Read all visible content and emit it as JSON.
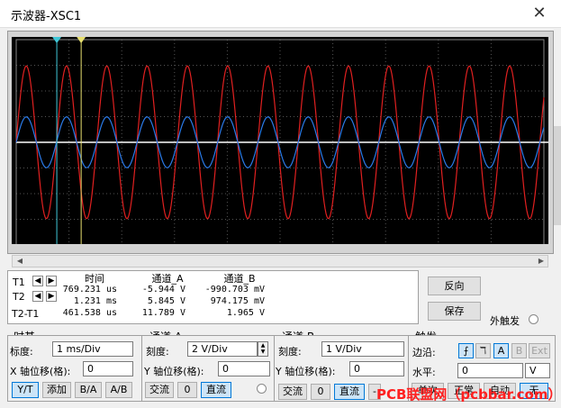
{
  "window": {
    "title": "示波器-XSC1"
  },
  "cursor_table": {
    "rows": [
      {
        "label": "T1",
        "time": "769.231 us",
        "chA": "-5.944 V",
        "chB": "-990.703 mV"
      },
      {
        "label": "T2",
        "time": "1.231 ms",
        "chA": "5.845 V",
        "chB": "974.175 mV"
      },
      {
        "label": "T2-T1",
        "time": "461.538 us",
        "chA": "11.789 V",
        "chB": "1.965 V"
      }
    ],
    "headers": {
      "time": "时间",
      "chA": "通道_A",
      "chB": "通道_B"
    }
  },
  "buttons": {
    "reverse": "反向",
    "save": "保存",
    "ext_trigger": "外触发"
  },
  "timebase": {
    "title": "时基",
    "scale_label": "标度:",
    "scale_value": "1 ms/Div",
    "xpos_label": "X 轴位移(格):",
    "xpos_value": "0",
    "modes": [
      "Y/T",
      "添加",
      "B/A",
      "A/B"
    ]
  },
  "channel_a": {
    "title": "通道 A",
    "scale_label": "刻度:",
    "scale_value": "2  V/Div",
    "ypos_label": "Y 轴位移(格):",
    "ypos_value": "0",
    "coupling": [
      "交流",
      "0",
      "直流"
    ]
  },
  "channel_b": {
    "title": "通道 B",
    "scale_label": "刻度:",
    "scale_value": "1  V/Div",
    "ypos_label": "Y 轴位移(格):",
    "ypos_value": "0",
    "coupling": [
      "交流",
      "0",
      "直流",
      "-"
    ]
  },
  "trigger": {
    "title": "触发",
    "edge_label": "边沿:",
    "edge_buttons": [
      "A",
      "B",
      "Ext"
    ],
    "level_label": "水平:",
    "level_value": "0",
    "level_unit": "V",
    "modes": [
      "单次",
      "正常",
      "自动",
      "无"
    ]
  },
  "watermark": "PCB联盟网（pcbbar.com）",
  "colors": {
    "channel_a": "#e02020",
    "channel_b": "#2a7ae8",
    "cursor_t1": "#40c8d8",
    "cursor_t2": "#e8e070",
    "screen_bg": "#000000",
    "grid": "#555555"
  },
  "scope_signals": {
    "channel_a": {
      "waveform": "sine",
      "scale_v_per_div": 2,
      "amplitude_v": 5.95
    },
    "channel_b": {
      "waveform": "sine",
      "scale_v_per_div": 1,
      "amplitude_v": 0.99
    },
    "timebase_ms_per_div": 1,
    "cursor_t1_us": 769.231,
    "cursor_t2_us": 1231
  }
}
